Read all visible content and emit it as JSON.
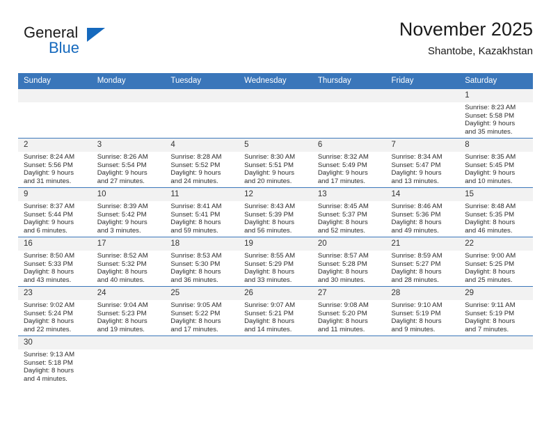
{
  "brand": {
    "logo_top": "General",
    "logo_bottom": "Blue",
    "accent_color": "#1569bd",
    "triangle_icon": "blue-triangle-icon"
  },
  "header": {
    "title": "November 2025",
    "subtitle": "Shantobe, Kazakhstan"
  },
  "calendar": {
    "header_bg": "#3a76ba",
    "daynum_bg": "#f2f2f2",
    "weekdays": [
      "Sunday",
      "Monday",
      "Tuesday",
      "Wednesday",
      "Thursday",
      "Friday",
      "Saturday"
    ],
    "weeks": [
      [
        {
          "day": "",
          "blank": true,
          "lines": []
        },
        {
          "day": "",
          "blank": true,
          "lines": []
        },
        {
          "day": "",
          "blank": true,
          "lines": []
        },
        {
          "day": "",
          "blank": true,
          "lines": []
        },
        {
          "day": "",
          "blank": true,
          "lines": []
        },
        {
          "day": "",
          "blank": true,
          "lines": []
        },
        {
          "day": "1",
          "blank": false,
          "lines": [
            "Sunrise: 8:23 AM",
            "Sunset: 5:58 PM",
            "Daylight: 9 hours",
            "and 35 minutes."
          ]
        }
      ],
      [
        {
          "day": "2",
          "blank": false,
          "lines": [
            "Sunrise: 8:24 AM",
            "Sunset: 5:56 PM",
            "Daylight: 9 hours",
            "and 31 minutes."
          ]
        },
        {
          "day": "3",
          "blank": false,
          "lines": [
            "Sunrise: 8:26 AM",
            "Sunset: 5:54 PM",
            "Daylight: 9 hours",
            "and 27 minutes."
          ]
        },
        {
          "day": "4",
          "blank": false,
          "lines": [
            "Sunrise: 8:28 AM",
            "Sunset: 5:52 PM",
            "Daylight: 9 hours",
            "and 24 minutes."
          ]
        },
        {
          "day": "5",
          "blank": false,
          "lines": [
            "Sunrise: 8:30 AM",
            "Sunset: 5:51 PM",
            "Daylight: 9 hours",
            "and 20 minutes."
          ]
        },
        {
          "day": "6",
          "blank": false,
          "lines": [
            "Sunrise: 8:32 AM",
            "Sunset: 5:49 PM",
            "Daylight: 9 hours",
            "and 17 minutes."
          ]
        },
        {
          "day": "7",
          "blank": false,
          "lines": [
            "Sunrise: 8:34 AM",
            "Sunset: 5:47 PM",
            "Daylight: 9 hours",
            "and 13 minutes."
          ]
        },
        {
          "day": "8",
          "blank": false,
          "lines": [
            "Sunrise: 8:35 AM",
            "Sunset: 5:45 PM",
            "Daylight: 9 hours",
            "and 10 minutes."
          ]
        }
      ],
      [
        {
          "day": "9",
          "blank": false,
          "lines": [
            "Sunrise: 8:37 AM",
            "Sunset: 5:44 PM",
            "Daylight: 9 hours",
            "and 6 minutes."
          ]
        },
        {
          "day": "10",
          "blank": false,
          "lines": [
            "Sunrise: 8:39 AM",
            "Sunset: 5:42 PM",
            "Daylight: 9 hours",
            "and 3 minutes."
          ]
        },
        {
          "day": "11",
          "blank": false,
          "lines": [
            "Sunrise: 8:41 AM",
            "Sunset: 5:41 PM",
            "Daylight: 8 hours",
            "and 59 minutes."
          ]
        },
        {
          "day": "12",
          "blank": false,
          "lines": [
            "Sunrise: 8:43 AM",
            "Sunset: 5:39 PM",
            "Daylight: 8 hours",
            "and 56 minutes."
          ]
        },
        {
          "day": "13",
          "blank": false,
          "lines": [
            "Sunrise: 8:45 AM",
            "Sunset: 5:37 PM",
            "Daylight: 8 hours",
            "and 52 minutes."
          ]
        },
        {
          "day": "14",
          "blank": false,
          "lines": [
            "Sunrise: 8:46 AM",
            "Sunset: 5:36 PM",
            "Daylight: 8 hours",
            "and 49 minutes."
          ]
        },
        {
          "day": "15",
          "blank": false,
          "lines": [
            "Sunrise: 8:48 AM",
            "Sunset: 5:35 PM",
            "Daylight: 8 hours",
            "and 46 minutes."
          ]
        }
      ],
      [
        {
          "day": "16",
          "blank": false,
          "lines": [
            "Sunrise: 8:50 AM",
            "Sunset: 5:33 PM",
            "Daylight: 8 hours",
            "and 43 minutes."
          ]
        },
        {
          "day": "17",
          "blank": false,
          "lines": [
            "Sunrise: 8:52 AM",
            "Sunset: 5:32 PM",
            "Daylight: 8 hours",
            "and 40 minutes."
          ]
        },
        {
          "day": "18",
          "blank": false,
          "lines": [
            "Sunrise: 8:53 AM",
            "Sunset: 5:30 PM",
            "Daylight: 8 hours",
            "and 36 minutes."
          ]
        },
        {
          "day": "19",
          "blank": false,
          "lines": [
            "Sunrise: 8:55 AM",
            "Sunset: 5:29 PM",
            "Daylight: 8 hours",
            "and 33 minutes."
          ]
        },
        {
          "day": "20",
          "blank": false,
          "lines": [
            "Sunrise: 8:57 AM",
            "Sunset: 5:28 PM",
            "Daylight: 8 hours",
            "and 30 minutes."
          ]
        },
        {
          "day": "21",
          "blank": false,
          "lines": [
            "Sunrise: 8:59 AM",
            "Sunset: 5:27 PM",
            "Daylight: 8 hours",
            "and 28 minutes."
          ]
        },
        {
          "day": "22",
          "blank": false,
          "lines": [
            "Sunrise: 9:00 AM",
            "Sunset: 5:25 PM",
            "Daylight: 8 hours",
            "and 25 minutes."
          ]
        }
      ],
      [
        {
          "day": "23",
          "blank": false,
          "lines": [
            "Sunrise: 9:02 AM",
            "Sunset: 5:24 PM",
            "Daylight: 8 hours",
            "and 22 minutes."
          ]
        },
        {
          "day": "24",
          "blank": false,
          "lines": [
            "Sunrise: 9:04 AM",
            "Sunset: 5:23 PM",
            "Daylight: 8 hours",
            "and 19 minutes."
          ]
        },
        {
          "day": "25",
          "blank": false,
          "lines": [
            "Sunrise: 9:05 AM",
            "Sunset: 5:22 PM",
            "Daylight: 8 hours",
            "and 17 minutes."
          ]
        },
        {
          "day": "26",
          "blank": false,
          "lines": [
            "Sunrise: 9:07 AM",
            "Sunset: 5:21 PM",
            "Daylight: 8 hours",
            "and 14 minutes."
          ]
        },
        {
          "day": "27",
          "blank": false,
          "lines": [
            "Sunrise: 9:08 AM",
            "Sunset: 5:20 PM",
            "Daylight: 8 hours",
            "and 11 minutes."
          ]
        },
        {
          "day": "28",
          "blank": false,
          "lines": [
            "Sunrise: 9:10 AM",
            "Sunset: 5:19 PM",
            "Daylight: 8 hours",
            "and 9 minutes."
          ]
        },
        {
          "day": "29",
          "blank": false,
          "lines": [
            "Sunrise: 9:11 AM",
            "Sunset: 5:19 PM",
            "Daylight: 8 hours",
            "and 7 minutes."
          ]
        }
      ],
      [
        {
          "day": "30",
          "blank": false,
          "lines": [
            "Sunrise: 9:13 AM",
            "Sunset: 5:18 PM",
            "Daylight: 8 hours",
            "and 4 minutes."
          ]
        },
        {
          "day": "",
          "blank": true,
          "lines": []
        },
        {
          "day": "",
          "blank": true,
          "lines": []
        },
        {
          "day": "",
          "blank": true,
          "lines": []
        },
        {
          "day": "",
          "blank": true,
          "lines": []
        },
        {
          "day": "",
          "blank": true,
          "lines": []
        },
        {
          "day": "",
          "blank": true,
          "lines": []
        }
      ]
    ]
  }
}
